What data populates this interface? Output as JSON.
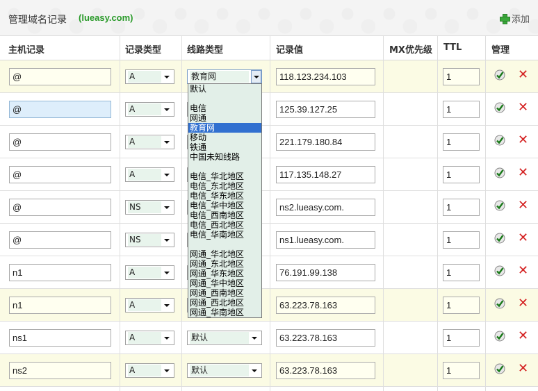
{
  "header": {
    "title": "管理域名记录",
    "domain": "(lueasy.com)",
    "add_label": "添加"
  },
  "columns": {
    "host": "主机记录",
    "type": "记录类型",
    "line": "线路类型",
    "value": "记录值",
    "mx": "MX优先级",
    "ttl": "TTL",
    "manage": "管理"
  },
  "rows": [
    {
      "host": "@",
      "type": "A",
      "line": "教育网",
      "value": "118.123.234.103",
      "mx": "",
      "ttl": "1",
      "highlight": true
    },
    {
      "host": "@",
      "type": "A",
      "line": "",
      "value": "125.39.127.25",
      "mx": "",
      "ttl": "1",
      "highlight": false
    },
    {
      "host": "@",
      "type": "A",
      "line": "",
      "value": "221.179.180.84",
      "mx": "",
      "ttl": "1",
      "highlight": false
    },
    {
      "host": "@",
      "type": "A",
      "line": "",
      "value": "117.135.148.27",
      "mx": "",
      "ttl": "1",
      "highlight": false
    },
    {
      "host": "@",
      "type": "NS",
      "line": "",
      "value": "ns2.lueasy.com.",
      "mx": "",
      "ttl": "1",
      "highlight": false
    },
    {
      "host": "@",
      "type": "NS",
      "line": "",
      "value": "ns1.lueasy.com.",
      "mx": "",
      "ttl": "1",
      "highlight": false
    },
    {
      "host": "n1",
      "type": "A",
      "line": "",
      "value": "76.191.99.138",
      "mx": "",
      "ttl": "1",
      "highlight": false
    },
    {
      "host": "n1",
      "type": "A",
      "line": "",
      "value": "63.223.78.163",
      "mx": "",
      "ttl": "1",
      "highlight": true
    },
    {
      "host": "ns1",
      "type": "A",
      "line": "默认",
      "value": "63.223.78.163",
      "mx": "",
      "ttl": "1",
      "highlight": false
    },
    {
      "host": "ns2",
      "type": "A",
      "line": "默认",
      "value": "63.223.78.163",
      "mx": "",
      "ttl": "1",
      "highlight": true
    }
  ],
  "line_options": [
    "默认",
    "",
    "电信",
    "网通",
    "教育网",
    "移动",
    "铁通",
    "中国未知线路",
    "",
    "电信_华北地区",
    "电信_东北地区",
    "电信_华东地区",
    "电信_华中地区",
    "电信_西南地区",
    "电信_西北地区",
    "电信_华南地区",
    "",
    "网通_华北地区",
    "网通_东北地区",
    "网通_华东地区",
    "网通_华中地区",
    "网通_西南地区",
    "网通_西北地区",
    "网通_华南地区"
  ],
  "selected_line_option": "教育网",
  "icons": {
    "add": "plus-icon",
    "save": "check-icon",
    "delete": "x-icon"
  },
  "colors": {
    "domain": "#2a9a2a",
    "highlight_row": "#fbfbe4",
    "delete": "#d42020",
    "dropdown_selected": "#3170d0"
  }
}
